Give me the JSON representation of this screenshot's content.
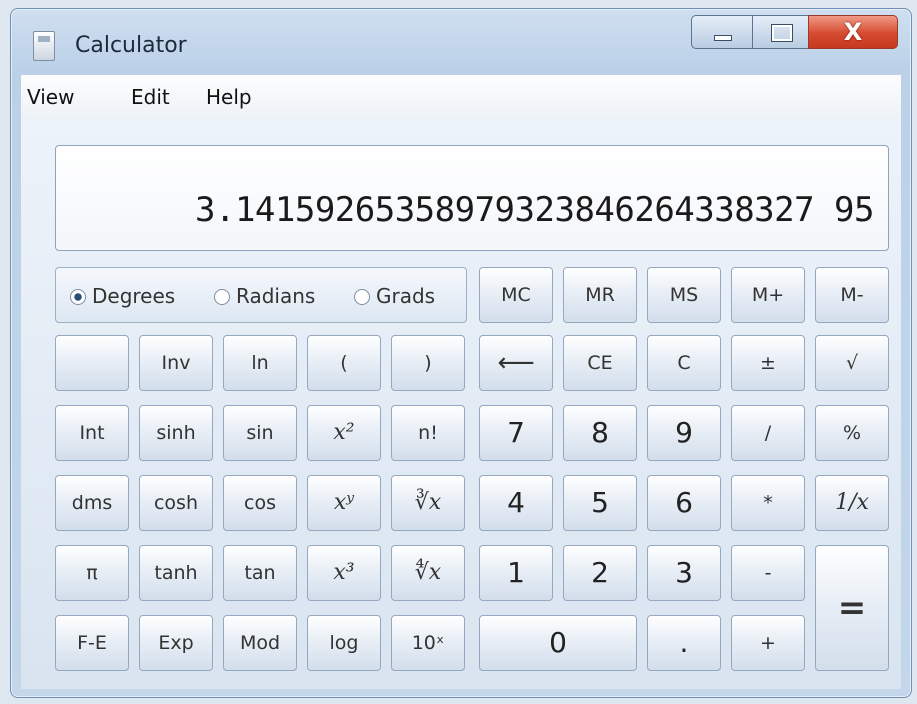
{
  "window": {
    "title": "Calculator",
    "controls": {
      "minimize": "",
      "maximize": "",
      "close": "X"
    }
  },
  "menu": [
    "View",
    "Edit",
    "Help"
  ],
  "display": {
    "value": "3.14159265358979323846264338327 95"
  },
  "angle_modes": {
    "selected": "Degrees",
    "options": [
      "Degrees",
      "Radians",
      "Grads"
    ]
  },
  "buttons": {
    "memory": [
      "MC",
      "MR",
      "MS",
      "M+",
      "M-"
    ],
    "row2": [
      "",
      "Inv",
      "ln",
      "(",
      ")",
      "⟵",
      "CE",
      "C",
      "±",
      "√"
    ],
    "row3": [
      "Int",
      "sinh",
      "sin",
      "x²",
      "n!",
      "7",
      "8",
      "9",
      "/",
      "%"
    ],
    "row4": [
      "dms",
      "cosh",
      "cos",
      "xʸ",
      "∛x",
      "4",
      "5",
      "6",
      "*",
      "1/x"
    ],
    "row5": [
      "π",
      "tanh",
      "tan",
      "x³",
      "∜x",
      "1",
      "2",
      "3",
      "-",
      "="
    ],
    "row6": [
      "F-E",
      "Exp",
      "Mod",
      "log",
      "10ˣ",
      "0",
      ".",
      "+"
    ]
  }
}
